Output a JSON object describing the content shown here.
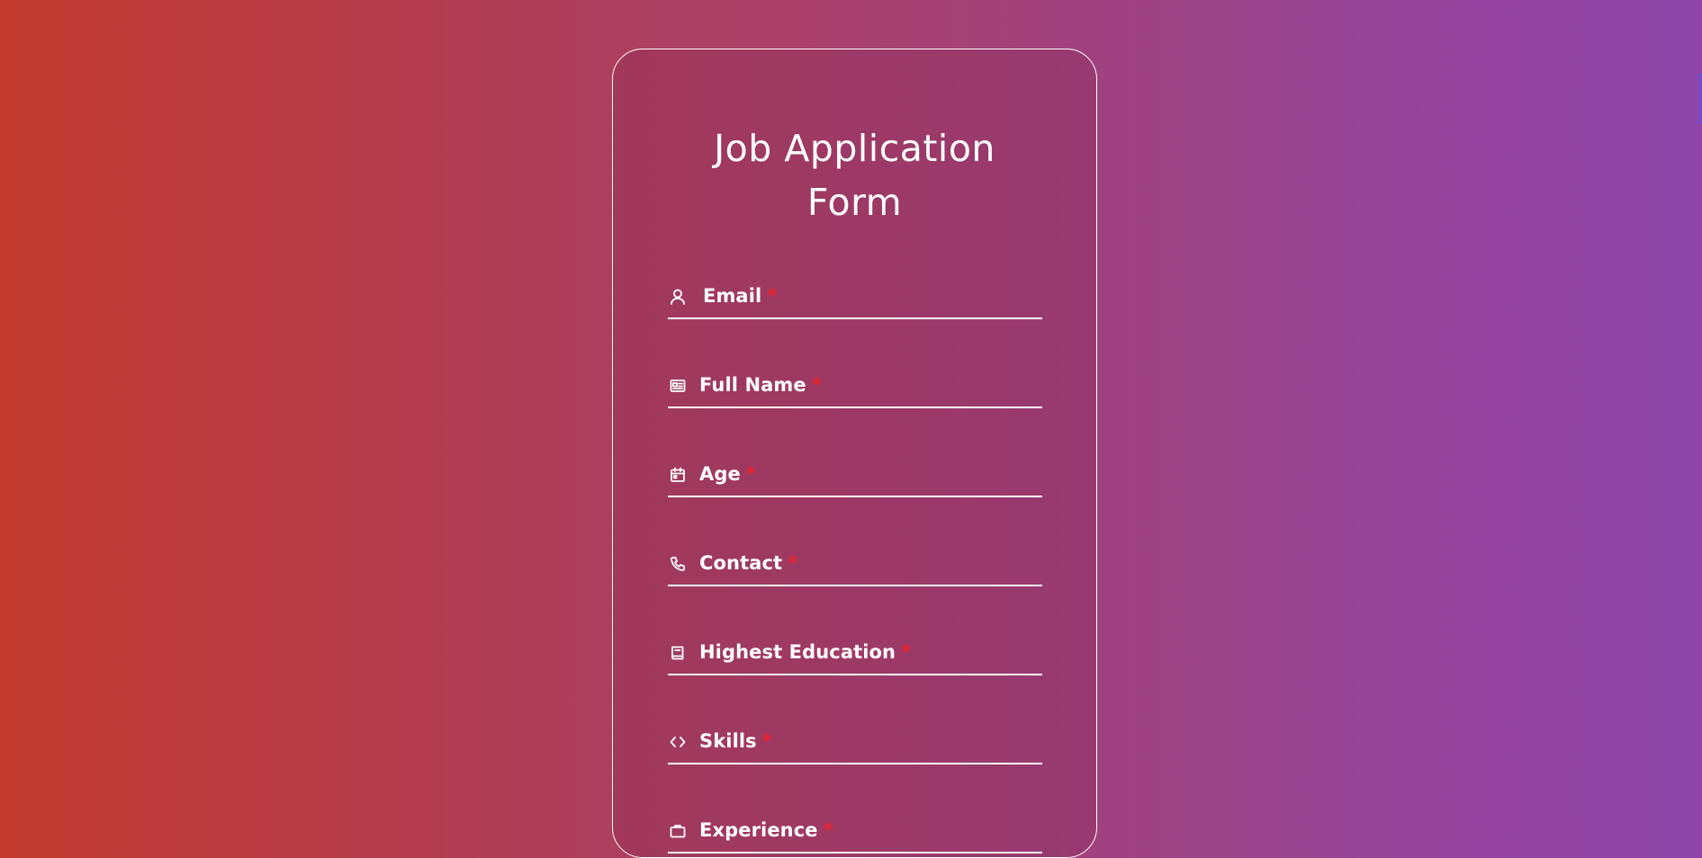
{
  "form": {
    "title_line1": "Job Application",
    "title_line2": "Form",
    "required_marker": "*",
    "fields": [
      {
        "label": "Email",
        "icon": "user-icon"
      },
      {
        "label": "Full Name",
        "icon": "id-card-icon"
      },
      {
        "label": "Age",
        "icon": "calendar-icon"
      },
      {
        "label": "Contact",
        "icon": "phone-icon"
      },
      {
        "label": "Highest Education",
        "icon": "book-icon"
      },
      {
        "label": "Skills",
        "icon": "code-icon"
      },
      {
        "label": "Experience",
        "icon": "briefcase-icon"
      }
    ]
  },
  "colors": {
    "background_start": "#c43b2e",
    "background_end": "#8e46ac",
    "text": "#ffffff",
    "required": "#e8242f"
  }
}
